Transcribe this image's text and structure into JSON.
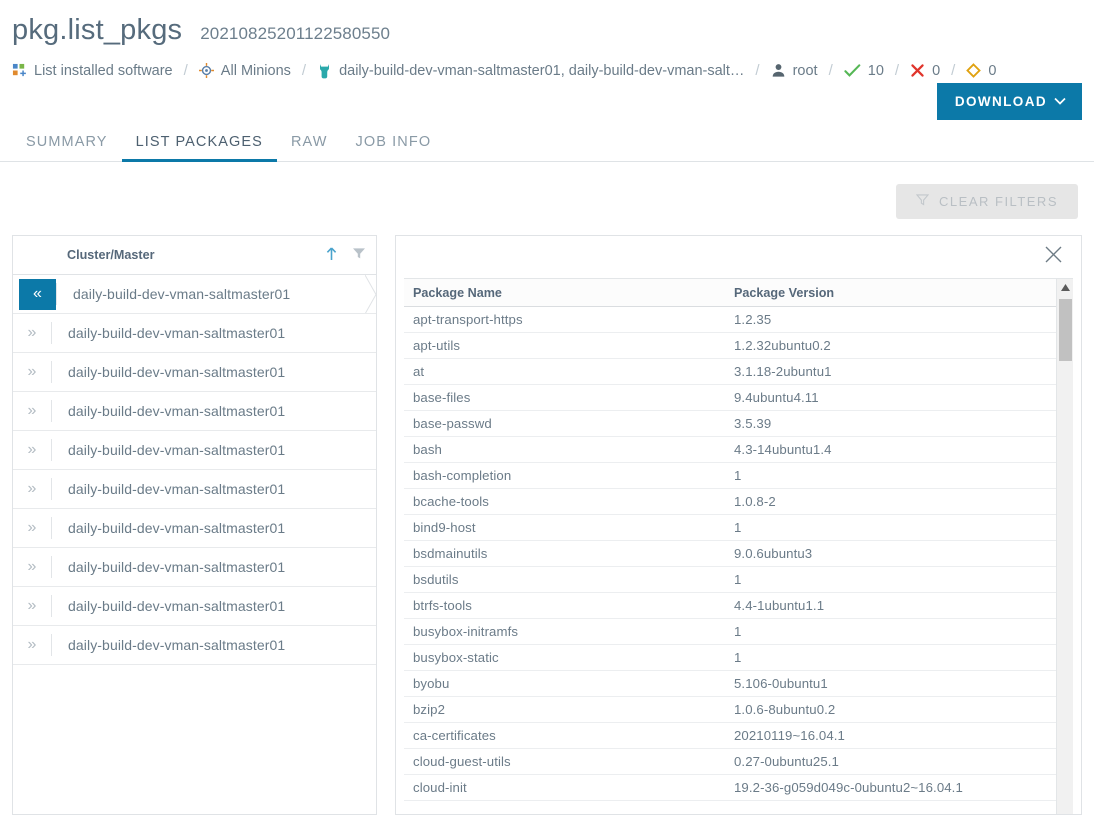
{
  "header": {
    "job_title": "pkg.list_pkgs",
    "job_id": "20210825201122580550",
    "breadcrumbs": [
      {
        "icon": "package-icon",
        "label": "List installed software"
      },
      {
        "icon": "target-icon",
        "label": "All Minions"
      },
      {
        "icon": "salt-minion-icon",
        "label": "daily-build-dev-vman-saltmaster01, daily-build-dev-vman-salt…"
      },
      {
        "icon": "user-icon",
        "label": "root"
      },
      {
        "icon": "check-icon",
        "label": "10"
      },
      {
        "icon": "x-icon",
        "label": "0"
      },
      {
        "icon": "diamond-icon",
        "label": "0"
      }
    ],
    "download_label": "DOWNLOAD",
    "download_caret": "⌄"
  },
  "tabs": [
    {
      "label": "SUMMARY",
      "active": false
    },
    {
      "label": "LIST PACKAGES",
      "active": true
    },
    {
      "label": "RAW",
      "active": false
    },
    {
      "label": "JOB INFO",
      "active": false
    }
  ],
  "toolbar": {
    "clear_filters_label": "CLEAR FILTERS",
    "filter_icon": "funnel-icon"
  },
  "left_panel": {
    "column_header": "Cluster/Master",
    "sort_icon": "sort-ascending-icon",
    "filter_icon": "funnel-icon",
    "rows": [
      {
        "name": "daily-build-dev-vman-saltmaster01",
        "selected": true,
        "expander": "«"
      },
      {
        "name": "daily-build-dev-vman-saltmaster01",
        "selected": false,
        "expander": "»"
      },
      {
        "name": "daily-build-dev-vman-saltmaster01",
        "selected": false,
        "expander": "»"
      },
      {
        "name": "daily-build-dev-vman-saltmaster01",
        "selected": false,
        "expander": "»"
      },
      {
        "name": "daily-build-dev-vman-saltmaster01",
        "selected": false,
        "expander": "»"
      },
      {
        "name": "daily-build-dev-vman-saltmaster01",
        "selected": false,
        "expander": "»"
      },
      {
        "name": "daily-build-dev-vman-saltmaster01",
        "selected": false,
        "expander": "»"
      },
      {
        "name": "daily-build-dev-vman-saltmaster01",
        "selected": false,
        "expander": "»"
      },
      {
        "name": "daily-build-dev-vman-saltmaster01",
        "selected": false,
        "expander": "»"
      },
      {
        "name": "daily-build-dev-vman-saltmaster01",
        "selected": false,
        "expander": "»"
      }
    ]
  },
  "right_panel": {
    "close_icon": "close-icon",
    "columns": [
      "Package Name",
      "Package Version"
    ],
    "rows": [
      [
        "apt-transport-https",
        "1.2.35"
      ],
      [
        "apt-utils",
        "1.2.32ubuntu0.2"
      ],
      [
        "at",
        "3.1.18-2ubuntu1"
      ],
      [
        "base-files",
        "9.4ubuntu4.11"
      ],
      [
        "base-passwd",
        "3.5.39"
      ],
      [
        "bash",
        "4.3-14ubuntu1.4"
      ],
      [
        "bash-completion",
        "1"
      ],
      [
        "bcache-tools",
        "1.0.8-2"
      ],
      [
        "bind9-host",
        "1"
      ],
      [
        "bsdmainutils",
        "9.0.6ubuntu3"
      ],
      [
        "bsdutils",
        "1"
      ],
      [
        "btrfs-tools",
        "4.4-1ubuntu1.1"
      ],
      [
        "busybox-initramfs",
        "1"
      ],
      [
        "busybox-static",
        "1"
      ],
      [
        "byobu",
        "5.106-0ubuntu1"
      ],
      [
        "bzip2",
        "1.0.6-8ubuntu0.2"
      ],
      [
        "ca-certificates",
        "20210119~16.04.1"
      ],
      [
        "cloud-guest-utils",
        "0.27-0ubuntu25.1"
      ],
      [
        "cloud-init",
        "19.2-36-g059d049c-0ubuntu2~16.04.1"
      ]
    ]
  },
  "colors": {
    "accent": "#0c79a8",
    "text": "#6a7b88",
    "success": "#5cb85c",
    "error": "#e03131",
    "warning": "#e0a800",
    "salt_teal": "#2aa9ab"
  }
}
